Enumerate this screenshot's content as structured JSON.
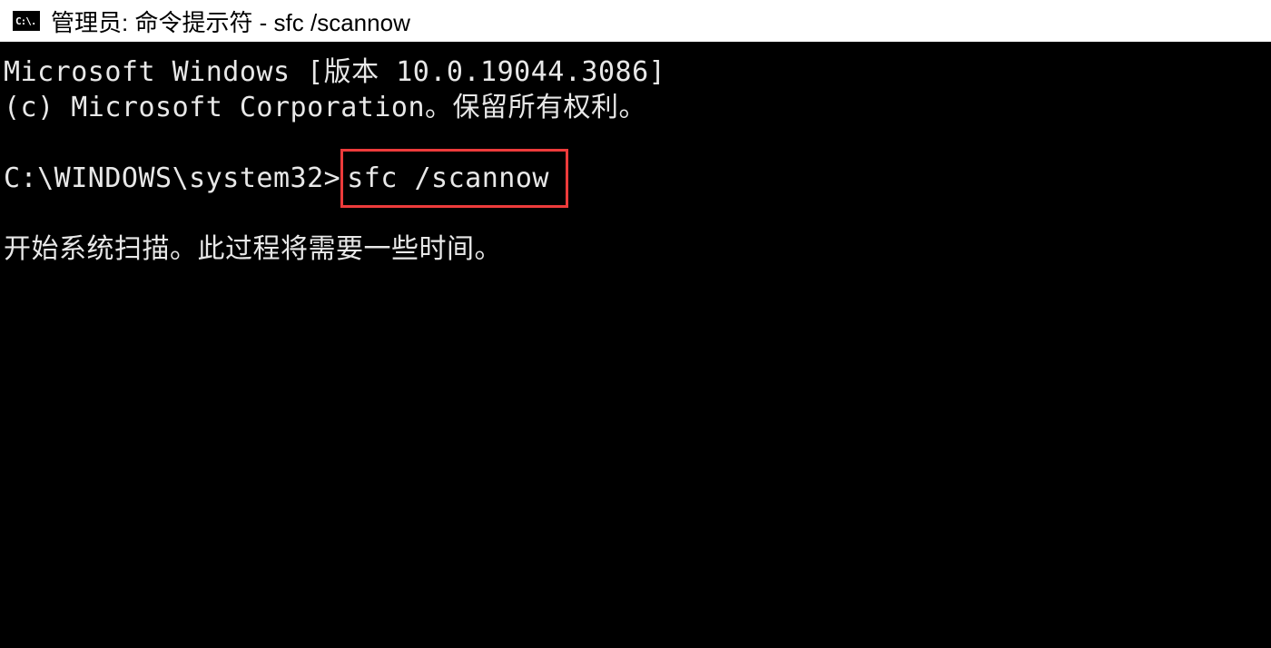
{
  "titlebar": {
    "icon_text": "C:\\.",
    "title": "管理员: 命令提示符 - sfc  /scannow"
  },
  "terminal": {
    "line1": "Microsoft Windows [版本 10.0.19044.3086]",
    "line2": "(c) Microsoft Corporation。保留所有权利。",
    "prompt": "C:\\WINDOWS\\system32>",
    "command": "sfc /scannow",
    "output1": "开始系统扫描。此过程将需要一些时间。"
  }
}
